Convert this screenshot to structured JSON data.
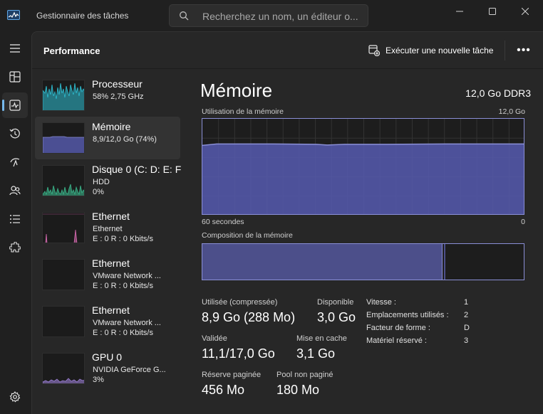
{
  "app": {
    "title": "Gestionnaire des tâches",
    "search_placeholder": "Recherchez un nom, un éditeur o..."
  },
  "rail": {
    "items": [
      "menu-icon",
      "processes-icon",
      "performance-icon",
      "history-icon",
      "startup-icon",
      "users-icon",
      "details-icon",
      "services-icon",
      "settings-icon"
    ],
    "active": "performance"
  },
  "header": {
    "title": "Performance",
    "run_task_label": "Exécuter une nouvelle tâche",
    "more_label": "•••"
  },
  "devices": [
    {
      "name": "Processeur",
      "line2": "58% 2,75 GHz",
      "line3": "",
      "color": "#2ec0d4",
      "selected": false
    },
    {
      "name": "Mémoire",
      "line2": "8,9/12,0 Go (74%)",
      "line3": "",
      "color": "#8a8fd6",
      "selected": true
    },
    {
      "name": "Disque 0 (C: D: E: F",
      "line2": "HDD",
      "line3": "0%",
      "color": "#3ab58a",
      "selected": false
    },
    {
      "name": "Ethernet",
      "line2": "Ethernet",
      "line3": "E : 0 R : 0 Kbits/s",
      "color": "#d66ab0",
      "selected": false
    },
    {
      "name": "Ethernet",
      "line2": "VMware Network ...",
      "line3": "E : 0 R : 0 Kbits/s",
      "color": "#d66ab0",
      "selected": false
    },
    {
      "name": "Ethernet",
      "line2": "VMware Network ...",
      "line3": "E : 0 R : 0 Kbits/s",
      "color": "#d66ab0",
      "selected": false
    },
    {
      "name": "GPU 0",
      "line2": "NVIDIA GeForce G...",
      "line3": "3%",
      "color": "#9b7fd4",
      "selected": false
    }
  ],
  "detail": {
    "title": "Mémoire",
    "spec": "12,0 Go DDR3",
    "usage_label": "Utilisation de la mémoire",
    "usage_max": "12,0 Go",
    "time_left": "60 secondes",
    "time_right": "0",
    "usage_fraction": 0.74,
    "composition_label": "Composition de la mémoire",
    "stats": {
      "used_label": "Utilisée (compressée)",
      "used_value": "8,9 Go (288 Mo)",
      "available_label": "Disponible",
      "available_value": "3,0 Go",
      "committed_label": "Validée",
      "committed_value": "11,1/17,0 Go",
      "cached_label": "Mise en cache",
      "cached_value": "3,1 Go",
      "paged_label": "Réserve paginée",
      "paged_value": "456 Mo",
      "nonpaged_label": "Pool non paginé",
      "nonpaged_value": "180 Mo"
    },
    "props": {
      "speed_label": "Vitesse :",
      "speed_value": "1",
      "slots_label": "Emplacements utilisés :",
      "slots_value": "2",
      "form_label": "Facteur de forme :",
      "form_value": "D",
      "reserved_label": "Matériel réservé :",
      "reserved_value": "3"
    }
  },
  "colors": {
    "accent": "#76b9ed",
    "memory": "#8a8fd6",
    "memory_fill": "#5358a8"
  }
}
